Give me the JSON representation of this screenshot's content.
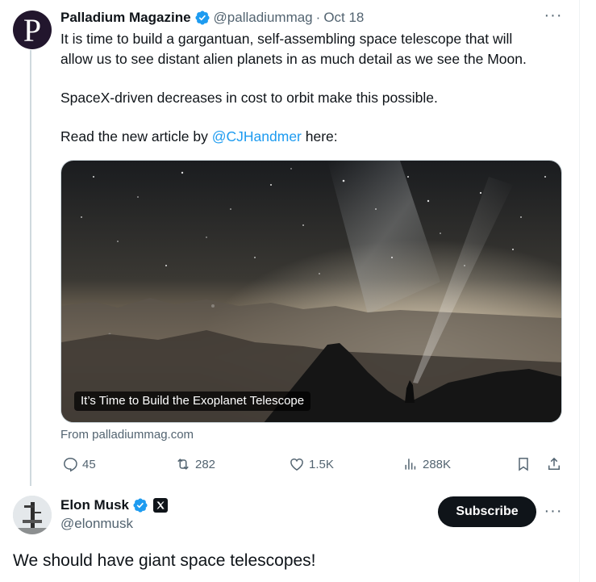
{
  "tweet1": {
    "avatar_letter": "P",
    "name": "Palladium Magazine",
    "handle": "@palladiummag",
    "separator": "·",
    "date": "Oct 18",
    "lines": [
      "It is time to build a gargantuan, self-assembling space telescope that will",
      "allow us to see distant alien planets in as much detail as we see the Moon.",
      "SpaceX-driven decreases in cost to orbit make this possible."
    ],
    "read_prefix": "Read the new article by ",
    "mention": "@CJHandmer",
    "read_suffix": " here:",
    "card": {
      "title": "It’s Time to Build the Exoplanet Telescope",
      "source": "From palladiummag.com"
    },
    "actions": {
      "replies": "45",
      "retweets": "282",
      "likes": "1.5K",
      "views": "288K"
    }
  },
  "tweet2": {
    "name": "Elon Musk",
    "handle": "@elonmusk",
    "subscribe_label": "Subscribe",
    "text": "We should have giant space telescopes!"
  },
  "icons": [
    "verified-badge-icon",
    "more-icon",
    "reply-icon",
    "retweet-icon",
    "like-icon",
    "views-icon",
    "bookmark-icon",
    "share-icon",
    "x-logo-icon"
  ],
  "colors": {
    "accent": "#1d9bf0",
    "text": "#0f1419",
    "secondary": "#536471"
  }
}
